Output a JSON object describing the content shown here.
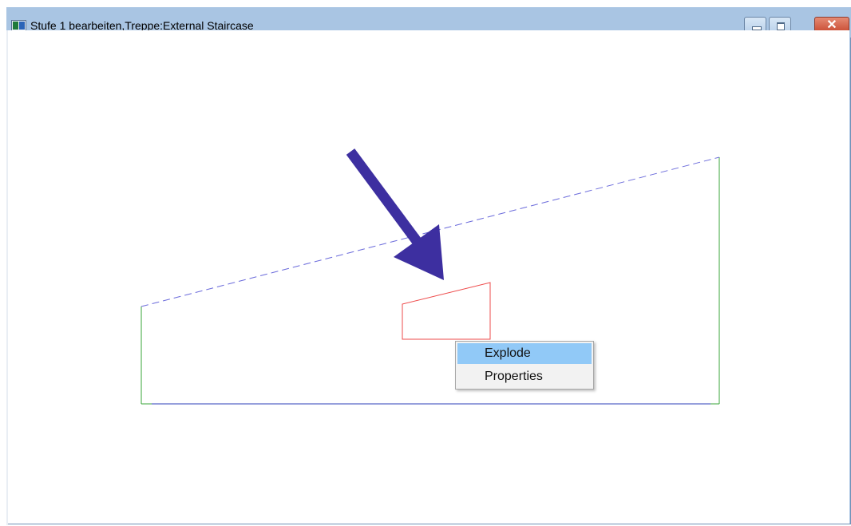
{
  "window": {
    "title": "Stufe 1 bearbeiten,Treppe:External Staircase",
    "controls": {
      "minimize_icon": "minimize-icon",
      "maximize_icon": "maximize-icon",
      "close_icon": "close-icon",
      "close_glyph": "✕"
    }
  },
  "context_menu": {
    "items": [
      {
        "label": "Explode",
        "highlighted": true
      },
      {
        "label": "Properties",
        "highlighted": false
      }
    ]
  },
  "colors": {
    "title_bar": "#a9c5e3",
    "outline_green": "#3aa63a",
    "dashed_blue": "#6b6bdb",
    "bottom_edge_blue": "#2e3fb8",
    "step_outline_red": "#ee4b4b",
    "arrow": "#3d2fa0",
    "menu_highlight": "#91c9f7",
    "close_button": "#c6452c"
  }
}
